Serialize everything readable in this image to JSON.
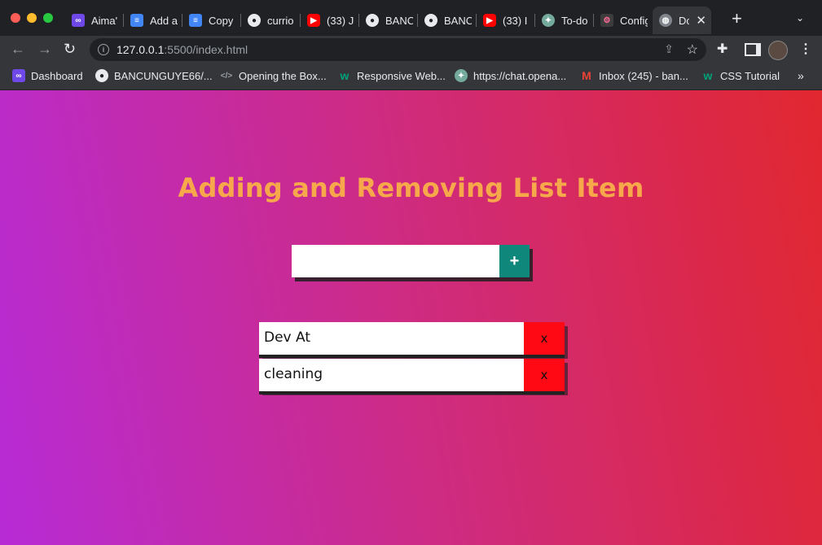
{
  "browser": {
    "tabs": [
      {
        "label": "Aima'",
        "icon": "aimas-icon"
      },
      {
        "label": "Add a",
        "icon": "google-docs-icon"
      },
      {
        "label": "Copy",
        "icon": "google-docs-icon"
      },
      {
        "label": "currio",
        "icon": "github-icon"
      },
      {
        "label": "(33) J",
        "icon": "youtube-icon"
      },
      {
        "label": "BANC",
        "icon": "github-icon"
      },
      {
        "label": "BANC",
        "icon": "github-icon"
      },
      {
        "label": "(33) I",
        "icon": "youtube-icon"
      },
      {
        "label": "To-do",
        "icon": "chatgpt-icon"
      },
      {
        "label": "Config",
        "icon": "config-icon"
      },
      {
        "label": "Do",
        "icon": "globe-icon",
        "active": true
      }
    ],
    "new_tab_label": "+",
    "address": {
      "host": "127.0.0.1",
      "rest": ":5500/index.html"
    },
    "bookmarks": [
      {
        "label": "Dashboard",
        "icon": "aimas-icon"
      },
      {
        "label": "BANCUNGUYE66/...",
        "icon": "github-icon"
      },
      {
        "label": "Opening the Box...",
        "icon": "code-icon"
      },
      {
        "label": "Responsive Web...",
        "icon": "w3schools-icon"
      },
      {
        "label": "https://chat.opena...",
        "icon": "chatgpt-icon"
      },
      {
        "label": "Inbox (245) - ban...",
        "icon": "gmail-icon"
      },
      {
        "label": "CSS Tutorial",
        "icon": "w3schools-icon"
      }
    ]
  },
  "page": {
    "title": "Adding and Removing List Item",
    "input_value": "",
    "add_button_label": "+",
    "items": [
      {
        "text": "Dev At",
        "delete_label": "x"
      },
      {
        "text": "cleaning",
        "delete_label": "x"
      }
    ],
    "colors": {
      "title": "#f7a84b",
      "add_button": "#0f877a",
      "delete_button": "#ff0a14",
      "gradient_start": "#b72bd6",
      "gradient_end": "#e1272f"
    }
  }
}
